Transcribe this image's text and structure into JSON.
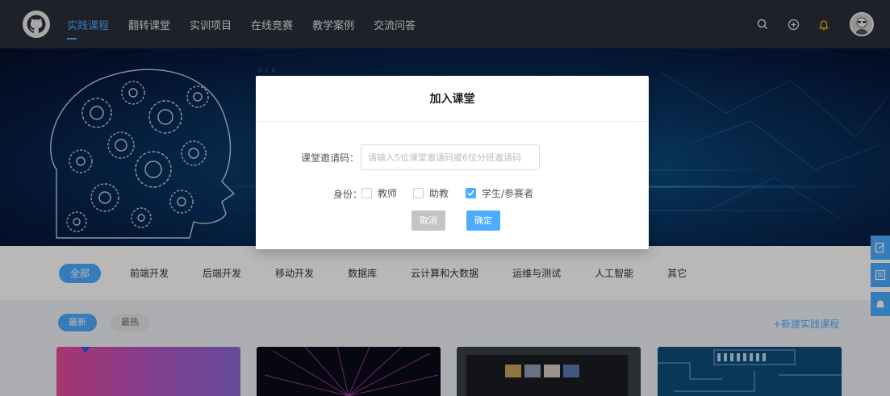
{
  "nav": {
    "items": [
      {
        "label": "实践课程",
        "active": true
      },
      {
        "label": "翻转课堂"
      },
      {
        "label": "实训项目"
      },
      {
        "label": "在线竞赛"
      },
      {
        "label": "教学案例"
      },
      {
        "label": "交流问答"
      }
    ],
    "right_icons": [
      "search-icon",
      "plus-circle-icon",
      "bell-icon"
    ]
  },
  "categories": [
    {
      "label": "全部",
      "active": true
    },
    {
      "label": "前端开发"
    },
    {
      "label": "后端开发"
    },
    {
      "label": "移动开发"
    },
    {
      "label": "数据库"
    },
    {
      "label": "云计算和大数据"
    },
    {
      "label": "运维与测试"
    },
    {
      "label": "人工智能"
    },
    {
      "label": "其它"
    }
  ],
  "filters": {
    "newest": "最新",
    "hottest": "最热"
  },
  "new_course_link": "+新建实践课程",
  "modal": {
    "title": "加入课堂",
    "code_label": "课堂邀请码：",
    "code_placeholder": "请输入5位课堂邀请码或6位分班邀请码",
    "code_value": "",
    "role_label": "身份：",
    "roles": [
      {
        "label": "教师",
        "checked": false
      },
      {
        "label": "助教",
        "checked": false
      },
      {
        "label": "学生/参赛者",
        "checked": true
      }
    ],
    "cancel": "取消",
    "confirm": "确定"
  },
  "colors": {
    "accent": "#4cacff",
    "nav_bg": "#2a2f3a"
  }
}
